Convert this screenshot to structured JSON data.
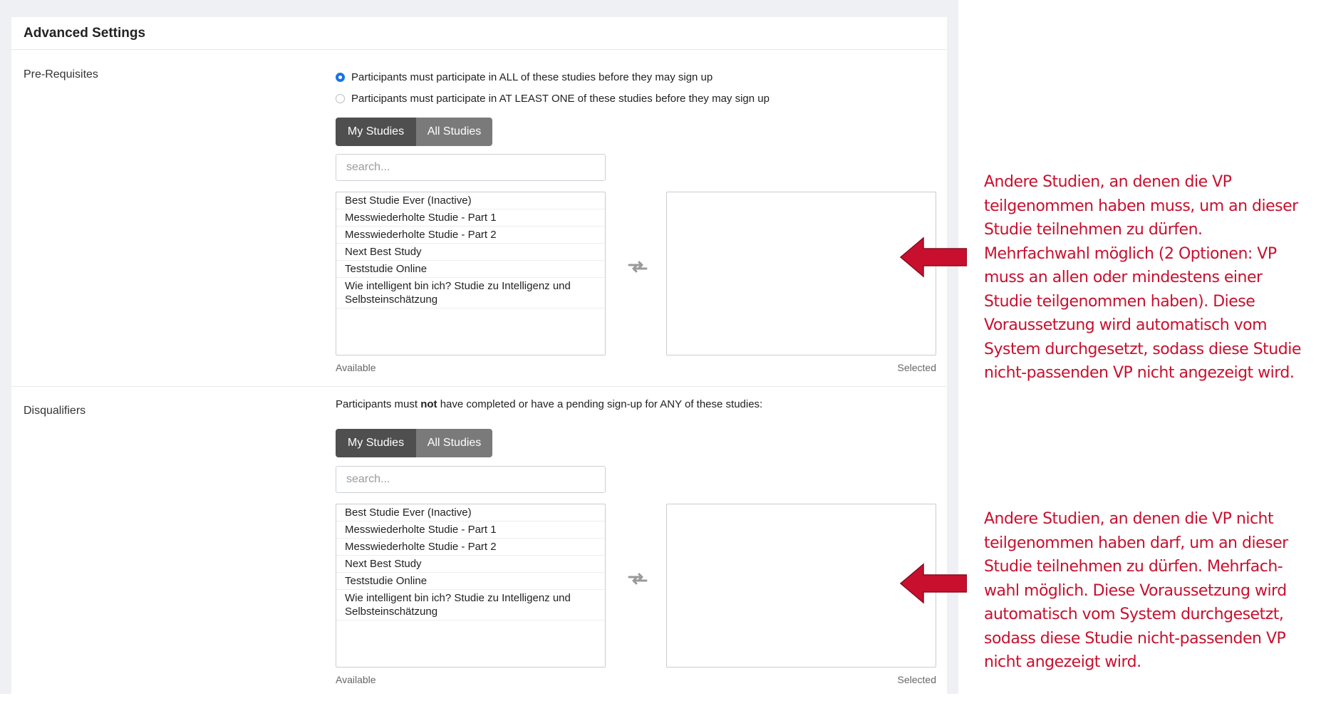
{
  "panel": {
    "title": "Advanced Settings"
  },
  "prerequisites": {
    "label": "Pre-Requisites",
    "radio_all": "Participants must participate in ALL of these studies before they may sign up",
    "radio_one": "Participants must participate in AT LEAST ONE of these studies before they may sign up",
    "selected_radio": "all"
  },
  "disqualifiers": {
    "label": "Disqualifiers",
    "info_prefix": "Participants must ",
    "info_bold": "not",
    "info_suffix": " have completed or have a pending sign-up for ANY of these studies:"
  },
  "toggle": {
    "my_studies": "My Studies",
    "all_studies": "All Studies",
    "active": "My Studies"
  },
  "search": {
    "placeholder": "search..."
  },
  "studies": [
    "Best Studie Ever (Inactive)",
    "Messwiederholte Studie - Part 1",
    "Messwiederholte Studie - Part 2",
    "Next Best Study",
    "Teststudie Online",
    "Wie intelligent bin ich? Studie zu Intelligenz und Selbsteinschätzung"
  ],
  "captions": {
    "available": "Available",
    "selected": "Selected"
  },
  "annotations": {
    "prerequisites": [
      "Andere Studien, an denen die VP",
      "teilgenommen haben muss, um an dieser",
      "Studie teilnehmen zu dürfen.",
      "Mehrfachwahl möglich (2 Optionen: VP",
      "muss an allen oder mindestens einer",
      "Studie teilgenommen haben). Diese",
      "Voraussetzung wird automatisch vom",
      "System durchgesetzt, sodass diese Studie",
      "nicht-passenden VP nicht angezeigt wird."
    ],
    "disqualifiers": [
      "Andere Studien, an denen die VP nicht",
      "teilgenommen haben darf, um an dieser",
      "Studie teilnehmen zu dürfen. Mehrfach-",
      "wahl möglich. Diese Voraussetzung wird",
      "automatisch vom System durchgesetzt,",
      "sodass diese Studie nicht-passenden VP",
      "nicht angezeigt wird."
    ]
  },
  "colors": {
    "annotation": "#c8102e",
    "radio_accent": "#1a73e8",
    "toggle_active": "#4f4f4f",
    "toggle_inactive": "#7a7a7a"
  }
}
